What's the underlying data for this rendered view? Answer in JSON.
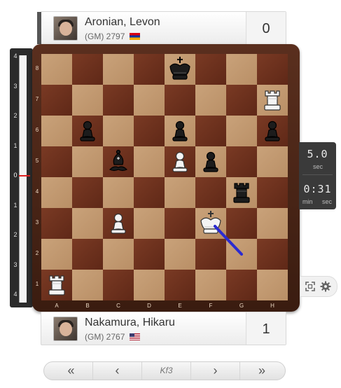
{
  "top_player": {
    "name": "Aronian, Levon",
    "title": "(GM)",
    "rating": "2797",
    "flag": "armenia",
    "score": "0"
  },
  "bottom_player": {
    "name": "Nakamura, Hikaru",
    "title": "(GM)",
    "rating": "2767",
    "flag": "usa",
    "score": "1"
  },
  "eval_bar": {
    "ticks": [
      "4",
      "3",
      "2",
      "1",
      "0",
      "1",
      "2",
      "3",
      "4"
    ],
    "value": 0
  },
  "board": {
    "files": [
      "A",
      "B",
      "C",
      "D",
      "E",
      "F",
      "G",
      "H"
    ],
    "ranks": [
      "8",
      "7",
      "6",
      "5",
      "4",
      "3",
      "2",
      "1"
    ],
    "pieces": [
      {
        "square": "e8",
        "type": "king",
        "color": "black"
      },
      {
        "square": "h7",
        "type": "rook",
        "color": "white"
      },
      {
        "square": "b6",
        "type": "pawn",
        "color": "black"
      },
      {
        "square": "e6",
        "type": "pawn",
        "color": "black"
      },
      {
        "square": "h6",
        "type": "pawn",
        "color": "black"
      },
      {
        "square": "c5",
        "type": "bishop",
        "color": "black"
      },
      {
        "square": "e5",
        "type": "pawn",
        "color": "white"
      },
      {
        "square": "f5",
        "type": "pawn",
        "color": "black"
      },
      {
        "square": "g4",
        "type": "rook",
        "color": "black"
      },
      {
        "square": "c3",
        "type": "pawn",
        "color": "white"
      },
      {
        "square": "f3",
        "type": "king",
        "color": "white"
      },
      {
        "square": "a1",
        "type": "rook",
        "color": "white"
      }
    ],
    "last_move": {
      "from": "g2",
      "to": "f3",
      "arrow_color": "#2b2bd0"
    }
  },
  "clock": {
    "increment": "5.0",
    "increment_unit": "sec",
    "time": "0:31",
    "min_label": "min",
    "sec_label": "sec"
  },
  "tools": {
    "fullscreen_icon": "fullscreen-icon",
    "settings_icon": "gear-icon"
  },
  "navigation": {
    "first": "«",
    "prev": "‹",
    "current_move": "Kf3",
    "next": "›",
    "last": "»"
  }
}
